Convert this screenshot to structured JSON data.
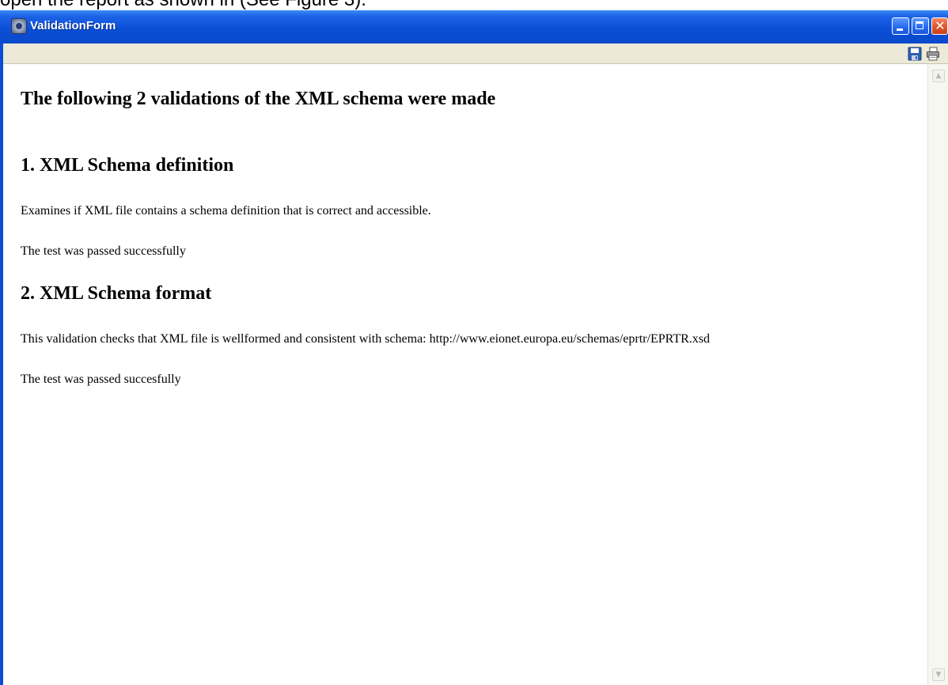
{
  "caption": "open the report as shown in (See Figure 3).",
  "window": {
    "title": "ValidationForm",
    "icon": "app-globe-icon",
    "controls": {
      "minimize_icon": "minimize-icon",
      "maximize_icon": "maximize-icon",
      "close_icon": "close-icon",
      "close_glyph": "✕"
    }
  },
  "toolbar": {
    "save_icon": "save-icon",
    "print_icon": "print-icon"
  },
  "report": {
    "heading": "The following 2 validations of the XML schema were made",
    "sections": [
      {
        "title": "1. XML Schema definition",
        "description": "Examines if XML file contains a schema definition that is correct and accessible.",
        "result": "The test was passed successfully"
      },
      {
        "title": "2. XML Schema format",
        "description": "This validation checks that XML file is wellformed and consistent with schema: http://www.eionet.europa.eu/schemas/eprtr/EPRTR.xsd",
        "result": "The test was passed succesfully"
      }
    ]
  },
  "scrollbar": {
    "up_glyph": "▲",
    "down_glyph": "▼"
  },
  "colors": {
    "titlebar": "#0a4fd6",
    "toolbar": "#ece9d8",
    "close_button": "#e2542a"
  }
}
